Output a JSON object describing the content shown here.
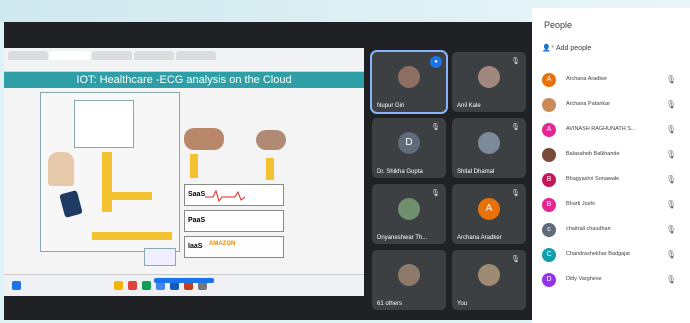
{
  "shared_screen": {
    "slide_title": "IOT: Healthcare -ECG analysis on the Cloud",
    "layers": [
      "SaaS",
      "PaaS",
      "IaaS"
    ],
    "iaas_logo": "AMAZON"
  },
  "tiles": [
    {
      "name": "Nupur Giri",
      "avatar_letter": "",
      "avatar_color": "#8d6e63",
      "speaking": true
    },
    {
      "name": "Anil Kale",
      "avatar_letter": "",
      "avatar_color": "#a1887f",
      "speaking": false
    },
    {
      "name": "Dr. Shikha Gupta",
      "avatar_letter": "D",
      "avatar_color": "#5f6b7a",
      "speaking": false
    },
    {
      "name": "Shital Dhamal",
      "avatar_letter": "",
      "avatar_color": "#7d8a99",
      "speaking": false
    },
    {
      "name": "Dnyaneshwar Th...",
      "avatar_letter": "",
      "avatar_color": "#6f8f6f",
      "speaking": false
    },
    {
      "name": "Archana Aradker",
      "avatar_letter": "A",
      "avatar_color": "#e8710a",
      "speaking": false
    },
    {
      "name": "61 others",
      "avatar_letter": "",
      "avatar_color": "#8c7b6b",
      "speaking": false
    },
    {
      "name": "You",
      "avatar_letter": "",
      "avatar_color": "#9e8b74",
      "speaking": false
    }
  ],
  "people_panel": {
    "title": "People",
    "add_label": "Add people",
    "list": [
      {
        "name": "Archana Aradker",
        "letter": "A",
        "color": "#e8710a"
      },
      {
        "name": "Archana Patankar",
        "letter": "",
        "color": "#c98b5a"
      },
      {
        "name": "AVINASH RAGHUNATH S...",
        "letter": "A",
        "color": "#e52592"
      },
      {
        "name": "Balasaheb Balkhande",
        "letter": "",
        "color": "#7a4a3a"
      },
      {
        "name": "Bhagyashri Sonawale",
        "letter": "B",
        "color": "#c2185b"
      },
      {
        "name": "Bharti Joshi",
        "letter": "B",
        "color": "#e52592"
      },
      {
        "name": "chaitrali chaudhari",
        "letter": "c",
        "color": "#5f6b7a"
      },
      {
        "name": "Chandrashekhar Badgajar",
        "letter": "C",
        "color": "#129eaf"
      },
      {
        "name": "Ditty Varghese",
        "letter": "D",
        "color": "#9334e6"
      }
    ]
  }
}
